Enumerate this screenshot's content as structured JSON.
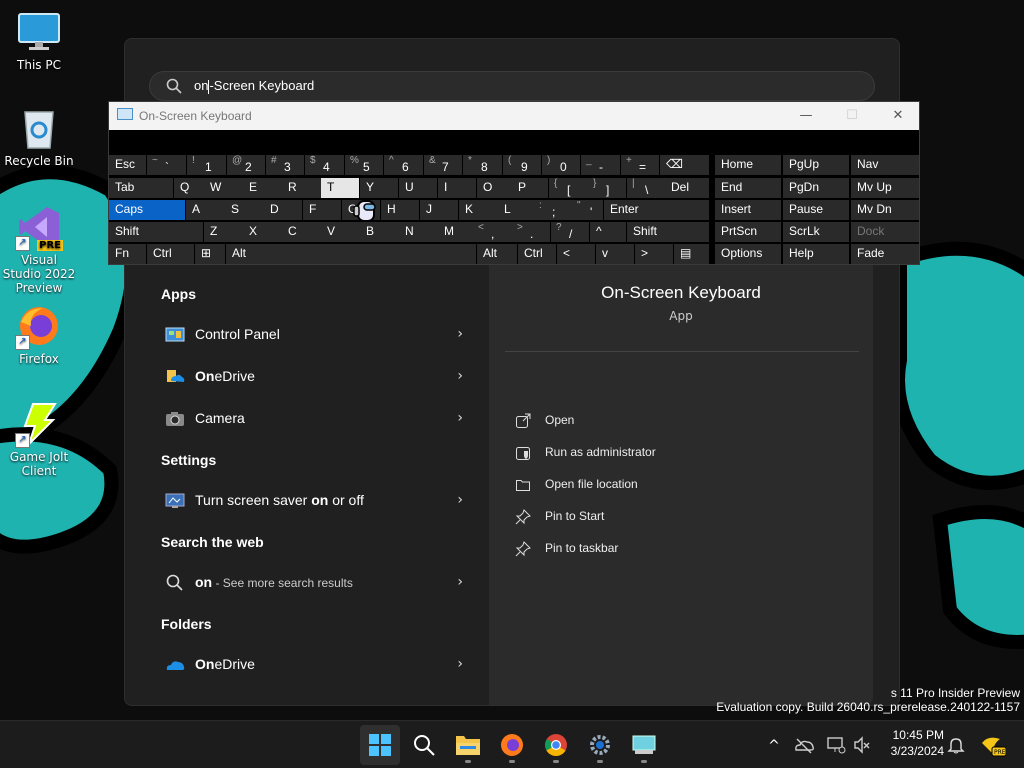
{
  "desktop": {
    "icons": [
      {
        "label": "This PC"
      },
      {
        "label": "Recycle Bin"
      },
      {
        "label": "Visual Studio 2022 Preview",
        "badge": "PRE"
      },
      {
        "label": "Firefox"
      },
      {
        "label": "Game Jolt Client"
      }
    ]
  },
  "search": {
    "query_typed": "on",
    "query_suggested": "-Screen Keyboard"
  },
  "results": {
    "sections": {
      "apps": "Apps",
      "settings": "Settings",
      "web": "Search the web",
      "folders": "Folders"
    },
    "apps": [
      {
        "label": "Control Panel"
      },
      {
        "label": "OneDrive",
        "bold": "On",
        "rest": "eDrive"
      },
      {
        "label": "Camera"
      }
    ],
    "settings": [
      {
        "pre": "Turn screen saver ",
        "bold": "on",
        "post": " or off"
      }
    ],
    "web": {
      "bold": "on",
      "rest": " - See more search results"
    },
    "folders": [
      {
        "bold": "On",
        "rest": "eDrive"
      }
    ],
    "chevron": "›"
  },
  "detail": {
    "title": "On-Screen Keyboard",
    "subtitle": "App",
    "actions": [
      {
        "label": "Open",
        "icon": "open-icon"
      },
      {
        "label": "Run as administrator",
        "icon": "shield-icon"
      },
      {
        "label": "Open file location",
        "icon": "folder-icon"
      },
      {
        "label": "Pin to Start",
        "icon": "pin-icon"
      },
      {
        "label": "Pin to taskbar",
        "icon": "pin-icon"
      }
    ]
  },
  "osk": {
    "title": "On-Screen Keyboard",
    "controls": {
      "minimize": "—",
      "maximize": "☐",
      "close": "✕"
    },
    "rows": [
      [
        {
          "t": "Esc"
        },
        {
          "s": "~",
          "m": "`"
        },
        {
          "s": "!",
          "m": "1"
        },
        {
          "s": "@",
          "m": "2"
        },
        {
          "s": "#",
          "m": "3"
        },
        {
          "s": "$",
          "m": "4"
        },
        {
          "s": "%",
          "m": "5"
        },
        {
          "s": "^",
          "m": "6"
        },
        {
          "s": "&",
          "m": "7"
        },
        {
          "s": "*",
          "m": "8"
        },
        {
          "s": "(",
          "m": "9"
        },
        {
          "s": ")",
          "m": "0"
        },
        {
          "s": "_",
          "m": "-"
        },
        {
          "s": "+",
          "m": "="
        },
        {
          "t": "⌫"
        }
      ],
      [
        {
          "t": "Tab"
        },
        {
          "t": "Q"
        },
        {
          "t": "W"
        },
        {
          "t": "E"
        },
        {
          "t": "R"
        },
        {
          "t": "T"
        },
        {
          "t": "Y"
        },
        {
          "t": "U"
        },
        {
          "t": "I"
        },
        {
          "t": "O"
        },
        {
          "t": "P"
        },
        {
          "s": "{",
          "m": "["
        },
        {
          "s": "}",
          "m": "]"
        },
        {
          "s": "|",
          "m": "\\"
        },
        {
          "t": "Del"
        }
      ],
      [
        {
          "t": "Caps"
        },
        {
          "t": "A"
        },
        {
          "t": "S"
        },
        {
          "t": "D"
        },
        {
          "t": "F"
        },
        {
          "t": "G"
        },
        {
          "t": "H"
        },
        {
          "t": "J"
        },
        {
          "t": "K"
        },
        {
          "t": "L"
        },
        {
          "s": ":",
          "m": ";"
        },
        {
          "s": "\"",
          "m": "'"
        },
        {
          "t": "Enter"
        }
      ],
      [
        {
          "t": "Shift"
        },
        {
          "t": "Z"
        },
        {
          "t": "X"
        },
        {
          "t": "C"
        },
        {
          "t": "V"
        },
        {
          "t": "B"
        },
        {
          "t": "N"
        },
        {
          "t": "M"
        },
        {
          "s": "<",
          "m": ","
        },
        {
          "s": ">",
          "m": "."
        },
        {
          "s": "?",
          "m": "/"
        },
        {
          "t": "^"
        },
        {
          "t": "Shift"
        }
      ],
      [
        {
          "t": "Fn"
        },
        {
          "t": "Ctrl"
        },
        {
          "t": "⊞"
        },
        {
          "t": "Alt"
        },
        {
          "t": ""
        },
        {
          "t": "Alt"
        },
        {
          "t": "Ctrl"
        },
        {
          "t": "<"
        },
        {
          "t": "v"
        },
        {
          "t": ">"
        },
        {
          "t": "▤"
        }
      ]
    ],
    "nav": [
      [
        "Home",
        "PgUp",
        "Nav"
      ],
      [
        "End",
        "PgDn",
        "Mv Up"
      ],
      [
        "Insert",
        "Pause",
        "Mv Dn"
      ],
      [
        "PrtScn",
        "ScrLk",
        "Dock"
      ],
      [
        "Options",
        "Help",
        "Fade"
      ]
    ]
  },
  "watermark": {
    "line1": "s 11 Pro Insider Preview",
    "line2": "Evaluation copy. Build 26040.rs_prerelease.240122-1157"
  },
  "taskbar": {
    "apps": [
      "start-icon",
      "search-icon",
      "file-explorer-icon",
      "firefox-icon",
      "chrome-icon",
      "settings-icon",
      "on-screen-keyboard-icon"
    ],
    "time": "10:45 PM",
    "date": "3/23/2024",
    "tray_up": "^"
  },
  "colors": {
    "accent": "#0a64c8",
    "wallpaper_teal": "#1fb3b0",
    "panel": "#202020",
    "detail": "#2b2b2b"
  }
}
